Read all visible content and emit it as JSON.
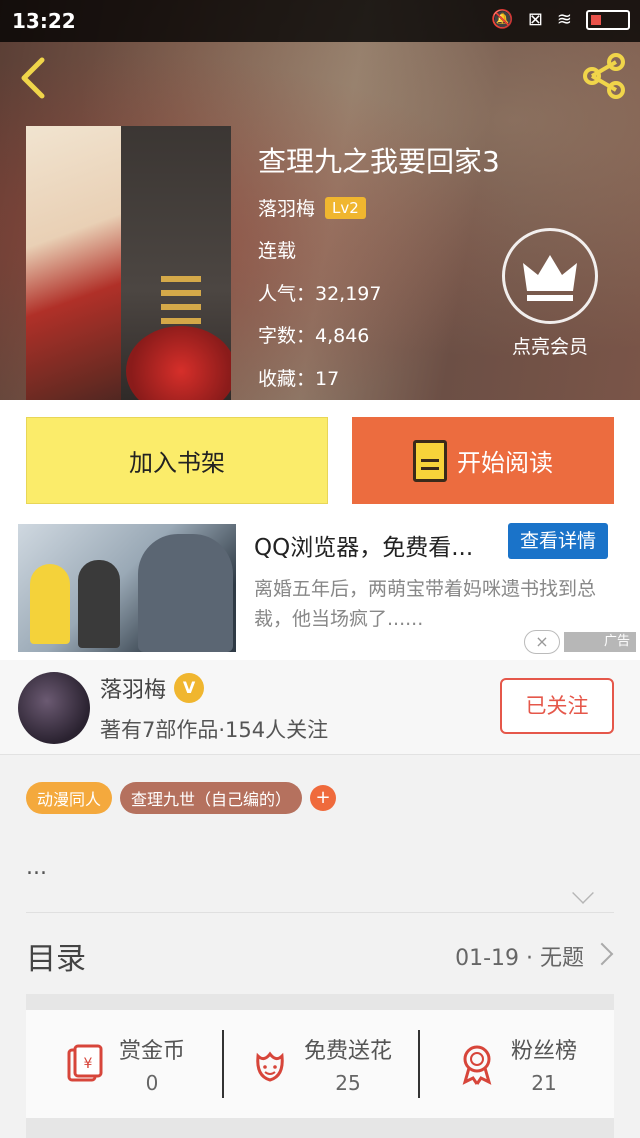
{
  "status_bar": {
    "time": "13:22"
  },
  "book": {
    "title": "查理九之我要回家3",
    "author": "落羽梅",
    "author_level": "Lv2",
    "status": "连载",
    "popularity": "人气：32,197",
    "word_count": "字数：4,846",
    "favorites": "收藏：17",
    "vip_label": "点亮会员"
  },
  "actions": {
    "add_shelf": "加入书架",
    "start_reading": "开始阅读"
  },
  "ad": {
    "title": "QQ浏览器，免费看...",
    "button": "查看详情",
    "description": "离婚五年后，两萌宝带着妈咪遗书找到总裁，他当场疯了......",
    "close": "×",
    "tag": "广告"
  },
  "author_card": {
    "name": "落羽梅",
    "badge": "V",
    "stats": "著有7部作品·154人关注",
    "follow_label": "已关注"
  },
  "tags": [
    "动漫同人",
    "查理九世（自己编的）"
  ],
  "tag_add": "+",
  "description": "...",
  "toc": {
    "label": "目录",
    "latest": "01-19 · 无题"
  },
  "stats": [
    {
      "label": "赏金币",
      "value": "0",
      "icon": "reward-coin-icon"
    },
    {
      "label": "免费送花",
      "value": "25",
      "icon": "flower-icon"
    },
    {
      "label": "粉丝榜",
      "value": "21",
      "icon": "medal-icon"
    }
  ],
  "colors": {
    "accent_orange": "#ec6c3f",
    "shelf_yellow": "#fbec6a",
    "level_gold": "#f0b62f",
    "follow_red": "#e5574a",
    "ad_blue": "#1a73c9"
  }
}
